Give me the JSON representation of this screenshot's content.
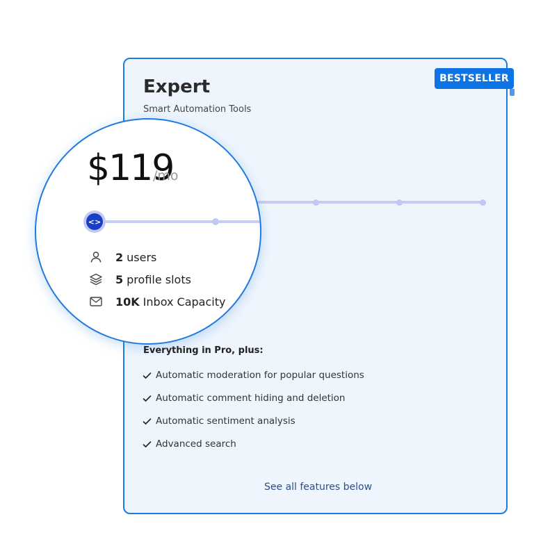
{
  "plan": {
    "badge": "BESTSELLER",
    "title": "Expert",
    "subtitle": "Smart Automation Tools",
    "price": "$119",
    "period": "/mo"
  },
  "slider": {
    "handle_icon": "code-arrows-icon",
    "level": 0
  },
  "stats": [
    {
      "icon": "user-icon",
      "value": "2",
      "label": "users"
    },
    {
      "icon": "layers-icon",
      "value": "5",
      "label": "profile slots"
    },
    {
      "icon": "mail-icon",
      "value": "10K",
      "label": "Inbox Capacity"
    }
  ],
  "features": {
    "heading": "Everything in Pro, plus:",
    "items": [
      "Automatic moderation for popular questions",
      "Automatic comment hiding and deletion",
      "Automatic sentiment analysis",
      "Advanced search"
    ]
  },
  "footer": {
    "see_all": "See all features below"
  },
  "colors": {
    "accent": "#1f7ae0",
    "badge": "#0d74e6",
    "card_bg": "#eef5fd",
    "handle": "#1a3fc7",
    "track": "#c6cdf5"
  }
}
